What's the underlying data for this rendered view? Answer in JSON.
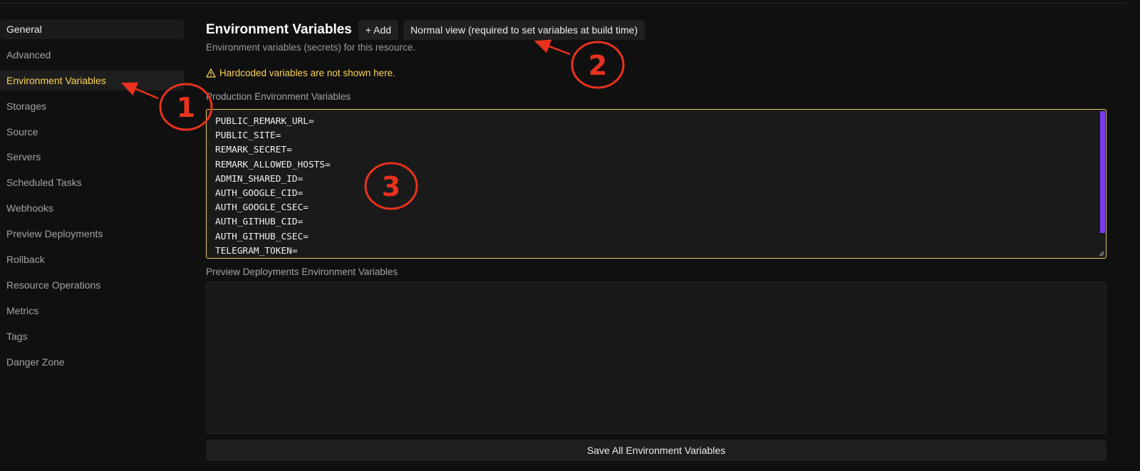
{
  "sidebar": {
    "items": [
      {
        "label": "General"
      },
      {
        "label": "Advanced"
      },
      {
        "label": "Environment Variables"
      },
      {
        "label": "Storages"
      },
      {
        "label": "Source"
      },
      {
        "label": "Servers"
      },
      {
        "label": "Scheduled Tasks"
      },
      {
        "label": "Webhooks"
      },
      {
        "label": "Preview Deployments"
      },
      {
        "label": "Rollback"
      },
      {
        "label": "Resource Operations"
      },
      {
        "label": "Metrics"
      },
      {
        "label": "Tags"
      },
      {
        "label": "Danger Zone"
      }
    ],
    "active_index": 2
  },
  "main": {
    "title": "Environment Variables",
    "add_label": "+ Add",
    "normal_view_label": "Normal view (required to set variables at build time)",
    "subtitle": "Environment variables (secrets) for this resource.",
    "warning": "Hardcoded variables are not shown here.",
    "production_label": "Production Environment Variables",
    "production_lines": [
      "PUBLIC_REMARK_URL=",
      "PUBLIC_SITE=",
      "REMARK_SECRET=",
      "REMARK_ALLOWED_HOSTS=",
      "ADMIN_SHARED_ID=",
      "AUTH_GOOGLE_CID=",
      "AUTH_GOOGLE_CSEC=",
      "AUTH_GITHUB_CID=",
      "AUTH_GITHUB_CSEC=",
      "TELEGRAM_TOKEN="
    ],
    "preview_label": "Preview Deployments Environment Variables",
    "save_label": "Save All Environment Variables"
  },
  "annotations": {
    "markers": [
      "1",
      "2",
      "3"
    ]
  },
  "colors": {
    "background": "#101010",
    "accent_yellow": "#fcd452",
    "scrollbar": "#7a3cf0",
    "annotation_red": "#e8321e"
  },
  "icons": {
    "warning": "warning-triangle-icon",
    "resize": "resize-handle-icon"
  }
}
